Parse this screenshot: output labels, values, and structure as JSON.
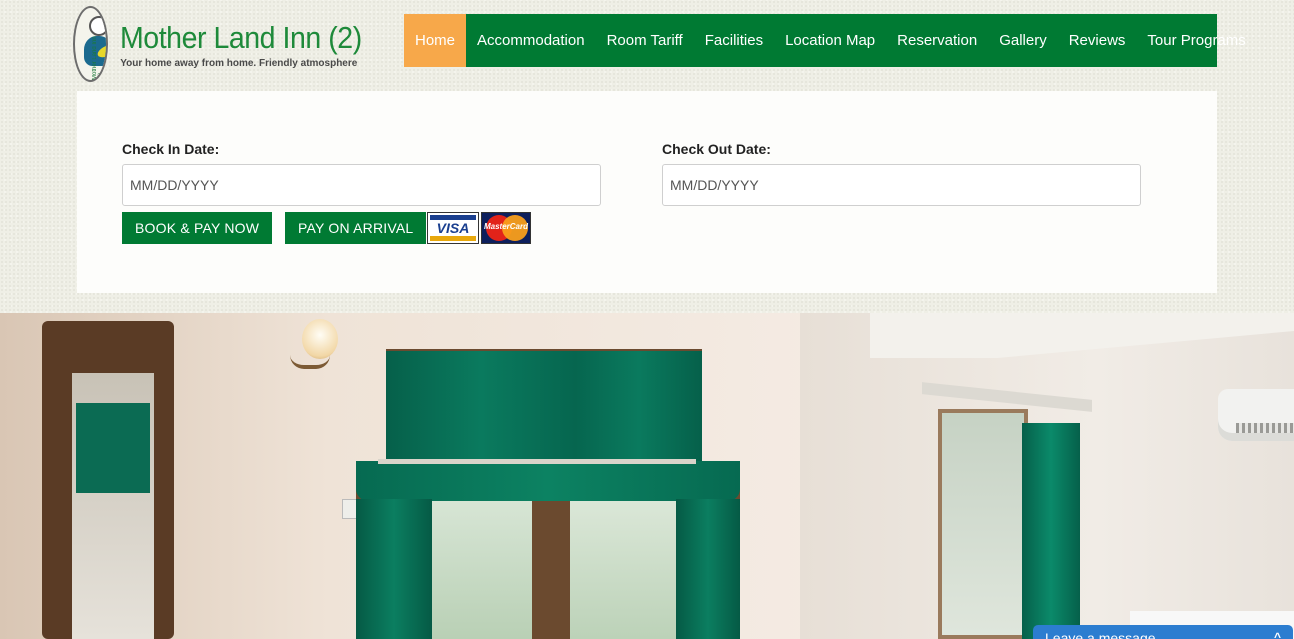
{
  "header": {
    "logo_title": "Mother Land Inn (2)",
    "logo_tagline": "Your home away from home. Friendly atmosphere",
    "logo_ring_text": "Mother Land Inn (2)"
  },
  "nav": {
    "items": [
      {
        "label": "Home",
        "active": true
      },
      {
        "label": "Accommodation"
      },
      {
        "label": "Room Tariff"
      },
      {
        "label": "Facilities"
      },
      {
        "label": "Location Map"
      },
      {
        "label": "Reservation"
      },
      {
        "label": "Gallery"
      },
      {
        "label": "Reviews"
      },
      {
        "label": "Tour Programs"
      }
    ]
  },
  "booking": {
    "check_in_label": "Check In Date:",
    "check_in_placeholder": "MM/DD/YYYY",
    "check_out_label": "Check Out Date:",
    "check_out_placeholder": "MM/DD/YYYY",
    "book_pay_label": "BOOK & PAY NOW",
    "pay_arrival_label": "PAY ON ARRIVAL",
    "visa_text": "VISA",
    "mastercard_text": "MasterCard"
  },
  "chat": {
    "label": "Leave a message",
    "caret": "^"
  },
  "colors": {
    "brand_green": "#007a33",
    "active_orange": "#f7a84a",
    "chat_blue": "#2c7dd0"
  }
}
